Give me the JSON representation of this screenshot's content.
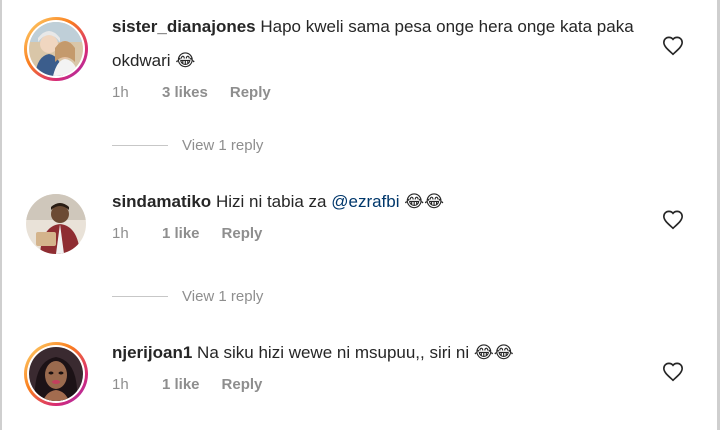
{
  "comments": [
    {
      "username": "sister_dianajones",
      "text": "Hapo kweli sama pesa onge hera onge kata paka okdwari",
      "emoji": "😂",
      "mention": "",
      "time": "1h",
      "likes": "3 likes",
      "reply_label": "Reply",
      "view_replies": "View 1 reply",
      "has_story_ring": true,
      "heart_icon": "heart-outline-icon"
    },
    {
      "username": "sindamatiko",
      "text": "Hizi ni tabia za",
      "emoji": "😂😂",
      "mention": "@ezrafbi",
      "time": "1h",
      "likes": "1 like",
      "reply_label": "Reply",
      "view_replies": "View 1 reply",
      "has_story_ring": false,
      "heart_icon": "heart-outline-icon"
    },
    {
      "username": "njerijoan1",
      "text": "Na siku hizi wewe ni msupuu,, siri ni",
      "emoji": "😂😂",
      "mention": "",
      "time": "1h",
      "likes": "1 like",
      "reply_label": "Reply",
      "view_replies": "",
      "has_story_ring": true,
      "heart_icon": "heart-outline-icon"
    }
  ],
  "colors": {
    "text": "#262626",
    "muted": "#8e8e8e",
    "mention": "#00376b",
    "ring_start": "#feda75",
    "ring_end": "#962fbf"
  }
}
